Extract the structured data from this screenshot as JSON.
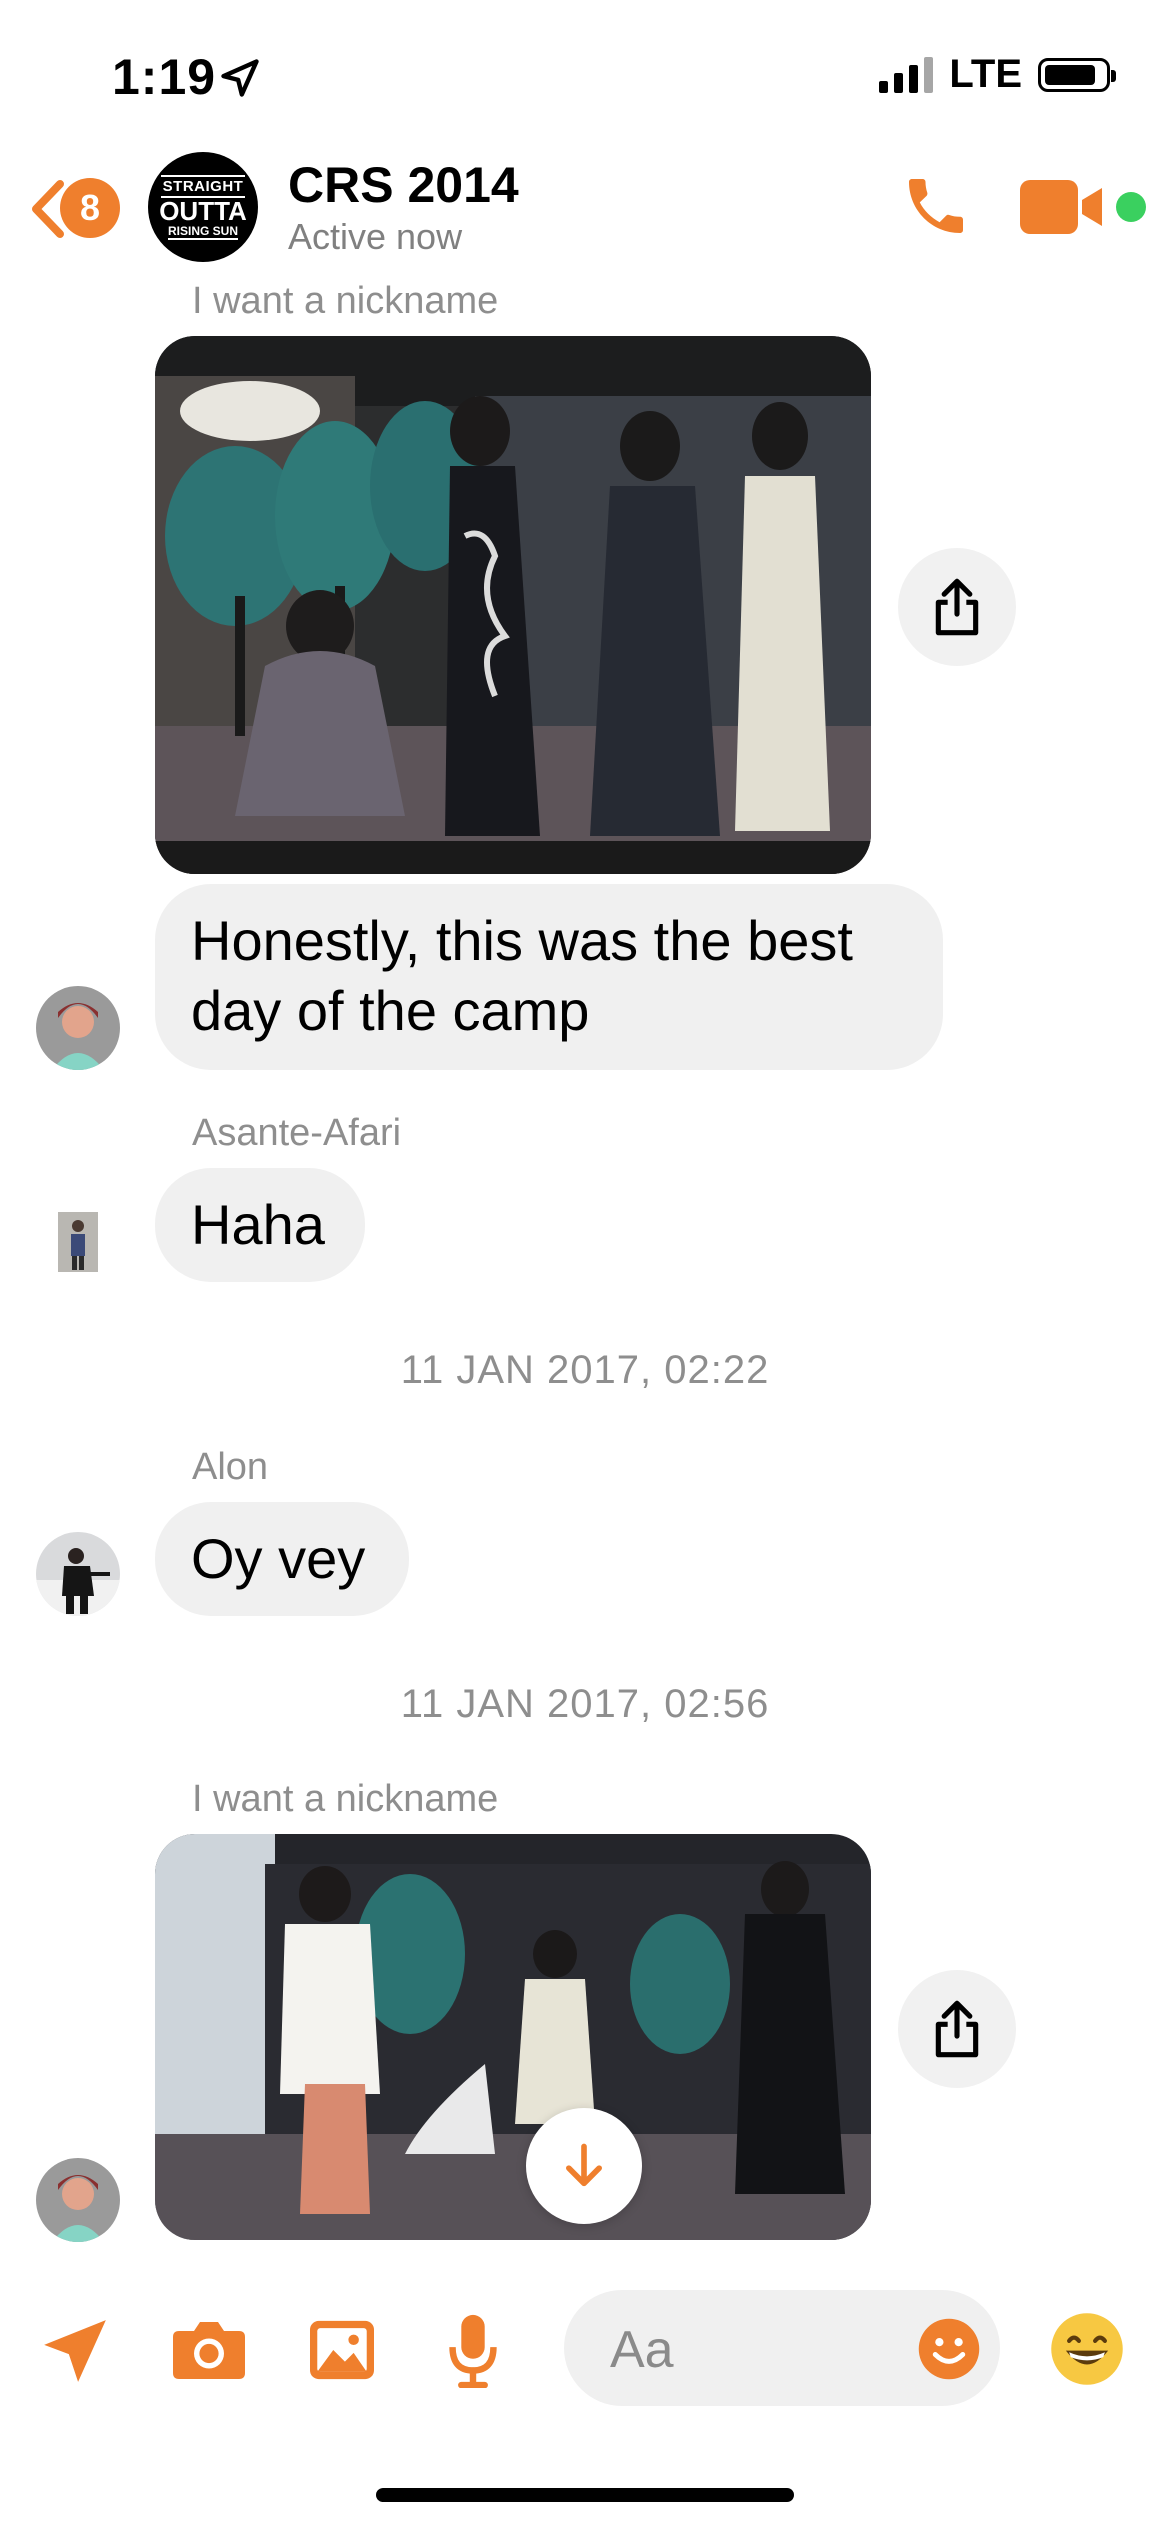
{
  "status_bar": {
    "time": "1:19",
    "network": "LTE"
  },
  "header": {
    "unread_count": "8",
    "group_avatar_text": [
      "STRAIGHT",
      "OUTTA",
      "RISING SUN"
    ],
    "title": "CRS 2014",
    "subtitle": "Active now"
  },
  "messages": {
    "m1_sender": "I want a nickname",
    "m2_text": "Honestly, this was the best day of the camp",
    "m3_sender": "Asante-Afari",
    "m3_text": "Haha",
    "ts1": "11 JAN 2017, 02:22",
    "m4_sender": "Alon",
    "m4_text": "Oy vey",
    "ts2": "11 JAN 2017, 02:56",
    "m5_sender": "I want a nickname"
  },
  "composer": {
    "placeholder": "Aa"
  },
  "colors": {
    "accent": "#ef7f2d",
    "online": "#3ad05f",
    "bubble": "#f0f0f0"
  },
  "icons": [
    "location-arrow-icon",
    "camera-icon",
    "gallery-icon",
    "microphone-icon",
    "smiley-icon",
    "grinning-emoji-icon",
    "share-icon",
    "arrow-down-icon",
    "phone-icon",
    "video-icon",
    "back-chevron-icon"
  ]
}
